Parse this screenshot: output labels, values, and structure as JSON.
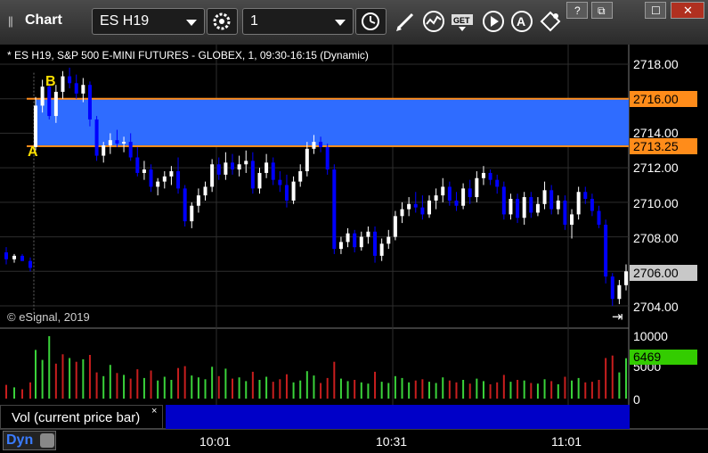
{
  "window": {
    "title": "Chart",
    "grip": "||",
    "symbol": "ES H19",
    "interval": "1",
    "icons": [
      "settings-gear-icon",
      "clock-icon",
      "pen-icon",
      "wave-icon",
      "get-icon",
      "play-icon",
      "annotate-icon",
      "diamond-icon"
    ],
    "window_buttons": [
      "help",
      "restore",
      "maximize",
      "close"
    ],
    "window_button_labels": [
      "?",
      "⧉",
      "☐",
      "✕"
    ]
  },
  "chart": {
    "header": "* ES H19, S&P 500 E-MINI FUTURES - GLOBEX, 1, 09:30-16:15 (Dynamic)",
    "watermark": "© eSignal, 2019",
    "price_ticks": [
      "2718.00",
      "2714.00",
      "2712.00",
      "2710.00",
      "2708.00",
      "2706.00",
      "2704.00"
    ],
    "price_tags": {
      "upper": "2716.00",
      "lower": "2713.25",
      "last": "2706.00"
    },
    "volume_ticks": [
      "10000",
      "5000",
      "0"
    ],
    "volume_tag": "6469",
    "time_ticks": [
      "10:01",
      "10:31",
      "11:01"
    ],
    "label_a": "A",
    "label_b": "B",
    "end_icon": "⇥"
  },
  "panel": {
    "volume_legend": "Vol (current price bar)",
    "close_glyph": "×",
    "mode": "Dyn"
  },
  "colors": {
    "zone_fill": "#2f6cff",
    "zone_line": "#ff8c1a",
    "down_bar": "#0000ff",
    "up_bar": "#ffffff",
    "vol_up": "#3ad33a",
    "vol_down": "#c81e1e",
    "last_tag": "#c8c8c8",
    "vol_tag": "#33cc00"
  },
  "chart_data": {
    "type": "candlestick",
    "symbol": "ES H19",
    "y_axis": {
      "min": 2703.2,
      "max": 2718.5,
      "label": ""
    },
    "zone": {
      "low": 2713.25,
      "high": 2716.0
    },
    "volume_axis": {
      "min": 0,
      "max": 11000
    },
    "last_price": 2706.0,
    "last_volume": 6469,
    "bars": [
      [
        2707.1,
        2707.4,
        2706.4,
        2706.7
      ],
      [
        2706.7,
        2707.0,
        2706.5,
        2706.9
      ],
      [
        2706.9,
        2707.0,
        2706.6,
        2706.6
      ],
      [
        2706.6,
        2706.8,
        2706.0,
        2706.2
      ],
      [
        2713.2,
        2716.1,
        2713.0,
        2715.6
      ],
      [
        2715.6,
        2717.1,
        2715.2,
        2716.7
      ],
      [
        2716.7,
        2716.9,
        2714.8,
        2715.0
      ],
      [
        2715.0,
        2716.8,
        2714.6,
        2716.4
      ],
      [
        2716.4,
        2717.6,
        2716.0,
        2717.3
      ],
      [
        2717.3,
        2717.8,
        2716.6,
        2716.9
      ],
      [
        2716.9,
        2717.4,
        2716.0,
        2716.3
      ],
      [
        2716.3,
        2717.2,
        2715.8,
        2716.8
      ],
      [
        2716.8,
        2717.0,
        2714.4,
        2714.8
      ],
      [
        2714.8,
        2715.0,
        2712.4,
        2712.7
      ],
      [
        2712.7,
        2713.5,
        2712.3,
        2713.3
      ],
      [
        2713.3,
        2714.0,
        2712.8,
        2713.6
      ],
      [
        2713.6,
        2714.2,
        2713.2,
        2713.4
      ],
      [
        2713.4,
        2713.8,
        2712.9,
        2713.5
      ],
      [
        2713.5,
        2714.0,
        2712.4,
        2712.6
      ],
      [
        2712.6,
        2713.2,
        2711.5,
        2711.7
      ],
      [
        2711.7,
        2712.4,
        2711.3,
        2711.9
      ],
      [
        2711.9,
        2712.2,
        2710.6,
        2710.9
      ],
      [
        2710.9,
        2711.4,
        2710.4,
        2711.2
      ],
      [
        2711.2,
        2711.8,
        2710.8,
        2711.5
      ],
      [
        2711.5,
        2712.1,
        2711.0,
        2711.8
      ],
      [
        2711.8,
        2712.6,
        2710.5,
        2710.8
      ],
      [
        2710.8,
        2711.0,
        2708.6,
        2708.9
      ],
      [
        2708.9,
        2710.0,
        2708.5,
        2709.8
      ],
      [
        2709.8,
        2710.8,
        2709.4,
        2710.4
      ],
      [
        2710.4,
        2711.2,
        2710.1,
        2710.9
      ],
      [
        2710.9,
        2712.5,
        2710.6,
        2712.2
      ],
      [
        2712.2,
        2712.6,
        2711.3,
        2711.6
      ],
      [
        2711.6,
        2712.9,
        2711.3,
        2712.3
      ],
      [
        2712.3,
        2712.8,
        2711.6,
        2711.9
      ],
      [
        2711.9,
        2712.7,
        2711.5,
        2712.2
      ],
      [
        2712.2,
        2713.0,
        2711.7,
        2712.4
      ],
      [
        2712.4,
        2712.9,
        2710.5,
        2710.8
      ],
      [
        2710.8,
        2712.0,
        2710.5,
        2711.7
      ],
      [
        2711.7,
        2712.8,
        2711.4,
        2712.3
      ],
      [
        2712.3,
        2712.6,
        2711.0,
        2711.3
      ],
      [
        2711.3,
        2711.8,
        2710.6,
        2711.0
      ],
      [
        2711.0,
        2711.6,
        2709.7,
        2710.1
      ],
      [
        2710.1,
        2711.5,
        2709.9,
        2711.2
      ],
      [
        2711.2,
        2712.2,
        2710.9,
        2711.8
      ],
      [
        2711.8,
        2713.5,
        2711.5,
        2713.1
      ],
      [
        2713.1,
        2713.9,
        2712.8,
        2713.5
      ],
      [
        2713.5,
        2713.8,
        2712.9,
        2713.2
      ],
      [
        2713.2,
        2713.4,
        2711.6,
        2711.9
      ],
      [
        2711.9,
        2712.2,
        2707.0,
        2707.3
      ],
      [
        2707.3,
        2708.0,
        2707.0,
        2707.7
      ],
      [
        2707.7,
        2708.5,
        2707.4,
        2708.2
      ],
      [
        2708.2,
        2708.4,
        2707.1,
        2707.4
      ],
      [
        2707.4,
        2708.3,
        2707.2,
        2708.0
      ],
      [
        2708.0,
        2708.6,
        2707.6,
        2708.3
      ],
      [
        2708.3,
        2708.6,
        2706.5,
        2706.9
      ],
      [
        2706.9,
        2707.9,
        2706.6,
        2707.6
      ],
      [
        2707.6,
        2708.4,
        2707.3,
        2708.0
      ],
      [
        2708.0,
        2709.5,
        2707.8,
        2709.2
      ],
      [
        2709.2,
        2710.0,
        2708.8,
        2709.6
      ],
      [
        2709.6,
        2710.3,
        2709.2,
        2709.9
      ],
      [
        2709.9,
        2710.6,
        2709.4,
        2709.7
      ],
      [
        2709.7,
        2710.4,
        2709.0,
        2709.3
      ],
      [
        2709.3,
        2710.4,
        2709.1,
        2710.1
      ],
      [
        2710.1,
        2710.8,
        2709.6,
        2710.4
      ],
      [
        2710.4,
        2711.4,
        2710.0,
        2710.9
      ],
      [
        2710.9,
        2711.2,
        2709.8,
        2710.1
      ],
      [
        2710.1,
        2710.6,
        2709.5,
        2709.8
      ],
      [
        2709.8,
        2711.1,
        2709.6,
        2710.8
      ],
      [
        2710.8,
        2711.3,
        2709.9,
        2710.3
      ],
      [
        2710.3,
        2711.8,
        2710.0,
        2711.4
      ],
      [
        2711.4,
        2712.1,
        2711.0,
        2711.7
      ],
      [
        2711.7,
        2711.9,
        2711.0,
        2711.3
      ],
      [
        2711.3,
        2711.6,
        2710.5,
        2710.9
      ],
      [
        2710.9,
        2711.2,
        2709.0,
        2709.3
      ],
      [
        2709.3,
        2710.5,
        2709.0,
        2710.2
      ],
      [
        2710.2,
        2710.5,
        2708.8,
        2709.1
      ],
      [
        2709.1,
        2710.6,
        2708.7,
        2710.3
      ],
      [
        2710.3,
        2710.6,
        2709.1,
        2709.4
      ],
      [
        2709.4,
        2710.3,
        2709.2,
        2709.9
      ],
      [
        2709.9,
        2711.2,
        2709.6,
        2710.7
      ],
      [
        2710.7,
        2711.0,
        2709.3,
        2709.6
      ],
      [
        2709.6,
        2710.4,
        2709.3,
        2710.1
      ],
      [
        2710.1,
        2710.4,
        2708.4,
        2708.7
      ],
      [
        2708.7,
        2709.6,
        2707.9,
        2709.3
      ],
      [
        2709.3,
        2710.9,
        2709.0,
        2710.6
      ],
      [
        2710.6,
        2710.9,
        2709.9,
        2710.2
      ],
      [
        2710.2,
        2710.5,
        2709.2,
        2709.5
      ],
      [
        2709.5,
        2709.8,
        2708.5,
        2708.7
      ],
      [
        2708.7,
        2709.0,
        2705.3,
        2705.7
      ],
      [
        2705.7,
        2705.9,
        2704.0,
        2704.4
      ],
      [
        2704.4,
        2705.5,
        2704.1,
        2705.2
      ],
      [
        2705.2,
        2706.4,
        2704.9,
        2706.0
      ]
    ],
    "volume": [
      [
        2200,
        "d"
      ],
      [
        1800,
        "u"
      ],
      [
        1500,
        "d"
      ],
      [
        2600,
        "d"
      ],
      [
        7800,
        "u"
      ],
      [
        6200,
        "u"
      ],
      [
        10000,
        "u"
      ],
      [
        5600,
        "d"
      ],
      [
        7100,
        "d"
      ],
      [
        6500,
        "u"
      ],
      [
        5900,
        "d"
      ],
      [
        6300,
        "u"
      ],
      [
        7000,
        "d"
      ],
      [
        4200,
        "d"
      ],
      [
        3600,
        "u"
      ],
      [
        5400,
        "u"
      ],
      [
        4100,
        "d"
      ],
      [
        3800,
        "u"
      ],
      [
        3200,
        "d"
      ],
      [
        4700,
        "d"
      ],
      [
        3300,
        "u"
      ],
      [
        4500,
        "d"
      ],
      [
        2900,
        "u"
      ],
      [
        3500,
        "u"
      ],
      [
        3000,
        "u"
      ],
      [
        4900,
        "d"
      ],
      [
        5200,
        "d"
      ],
      [
        3700,
        "u"
      ],
      [
        3400,
        "u"
      ],
      [
        3100,
        "u"
      ],
      [
        5100,
        "u"
      ],
      [
        3600,
        "d"
      ],
      [
        4800,
        "u"
      ],
      [
        3200,
        "d"
      ],
      [
        3400,
        "u"
      ],
      [
        2800,
        "u"
      ],
      [
        4300,
        "d"
      ],
      [
        3000,
        "u"
      ],
      [
        3500,
        "u"
      ],
      [
        2700,
        "d"
      ],
      [
        3100,
        "d"
      ],
      [
        3900,
        "d"
      ],
      [
        2600,
        "u"
      ],
      [
        2900,
        "u"
      ],
      [
        4400,
        "u"
      ],
      [
        3700,
        "u"
      ],
      [
        2500,
        "d"
      ],
      [
        3300,
        "d"
      ],
      [
        5900,
        "d"
      ],
      [
        3200,
        "u"
      ],
      [
        2800,
        "u"
      ],
      [
        3000,
        "d"
      ],
      [
        2600,
        "u"
      ],
      [
        2400,
        "u"
      ],
      [
        4300,
        "d"
      ],
      [
        2700,
        "u"
      ],
      [
        2500,
        "u"
      ],
      [
        3600,
        "u"
      ],
      [
        3300,
        "u"
      ],
      [
        2600,
        "u"
      ],
      [
        2900,
        "d"
      ],
      [
        3100,
        "d"
      ],
      [
        2700,
        "u"
      ],
      [
        2500,
        "u"
      ],
      [
        3400,
        "u"
      ],
      [
        2900,
        "d"
      ],
      [
        2600,
        "d"
      ],
      [
        3000,
        "u"
      ],
      [
        2400,
        "d"
      ],
      [
        3200,
        "u"
      ],
      [
        2800,
        "u"
      ],
      [
        2300,
        "d"
      ],
      [
        2600,
        "d"
      ],
      [
        3800,
        "d"
      ],
      [
        2700,
        "u"
      ],
      [
        3000,
        "d"
      ],
      [
        2900,
        "u"
      ],
      [
        2500,
        "d"
      ],
      [
        2400,
        "u"
      ],
      [
        3100,
        "u"
      ],
      [
        2800,
        "d"
      ],
      [
        2300,
        "u"
      ],
      [
        3500,
        "d"
      ],
      [
        2900,
        "u"
      ],
      [
        3300,
        "u"
      ],
      [
        2600,
        "d"
      ],
      [
        2700,
        "d"
      ],
      [
        3000,
        "d"
      ],
      [
        6500,
        "d"
      ],
      [
        6900,
        "d"
      ],
      [
        4200,
        "u"
      ],
      [
        6469,
        "u"
      ]
    ]
  }
}
